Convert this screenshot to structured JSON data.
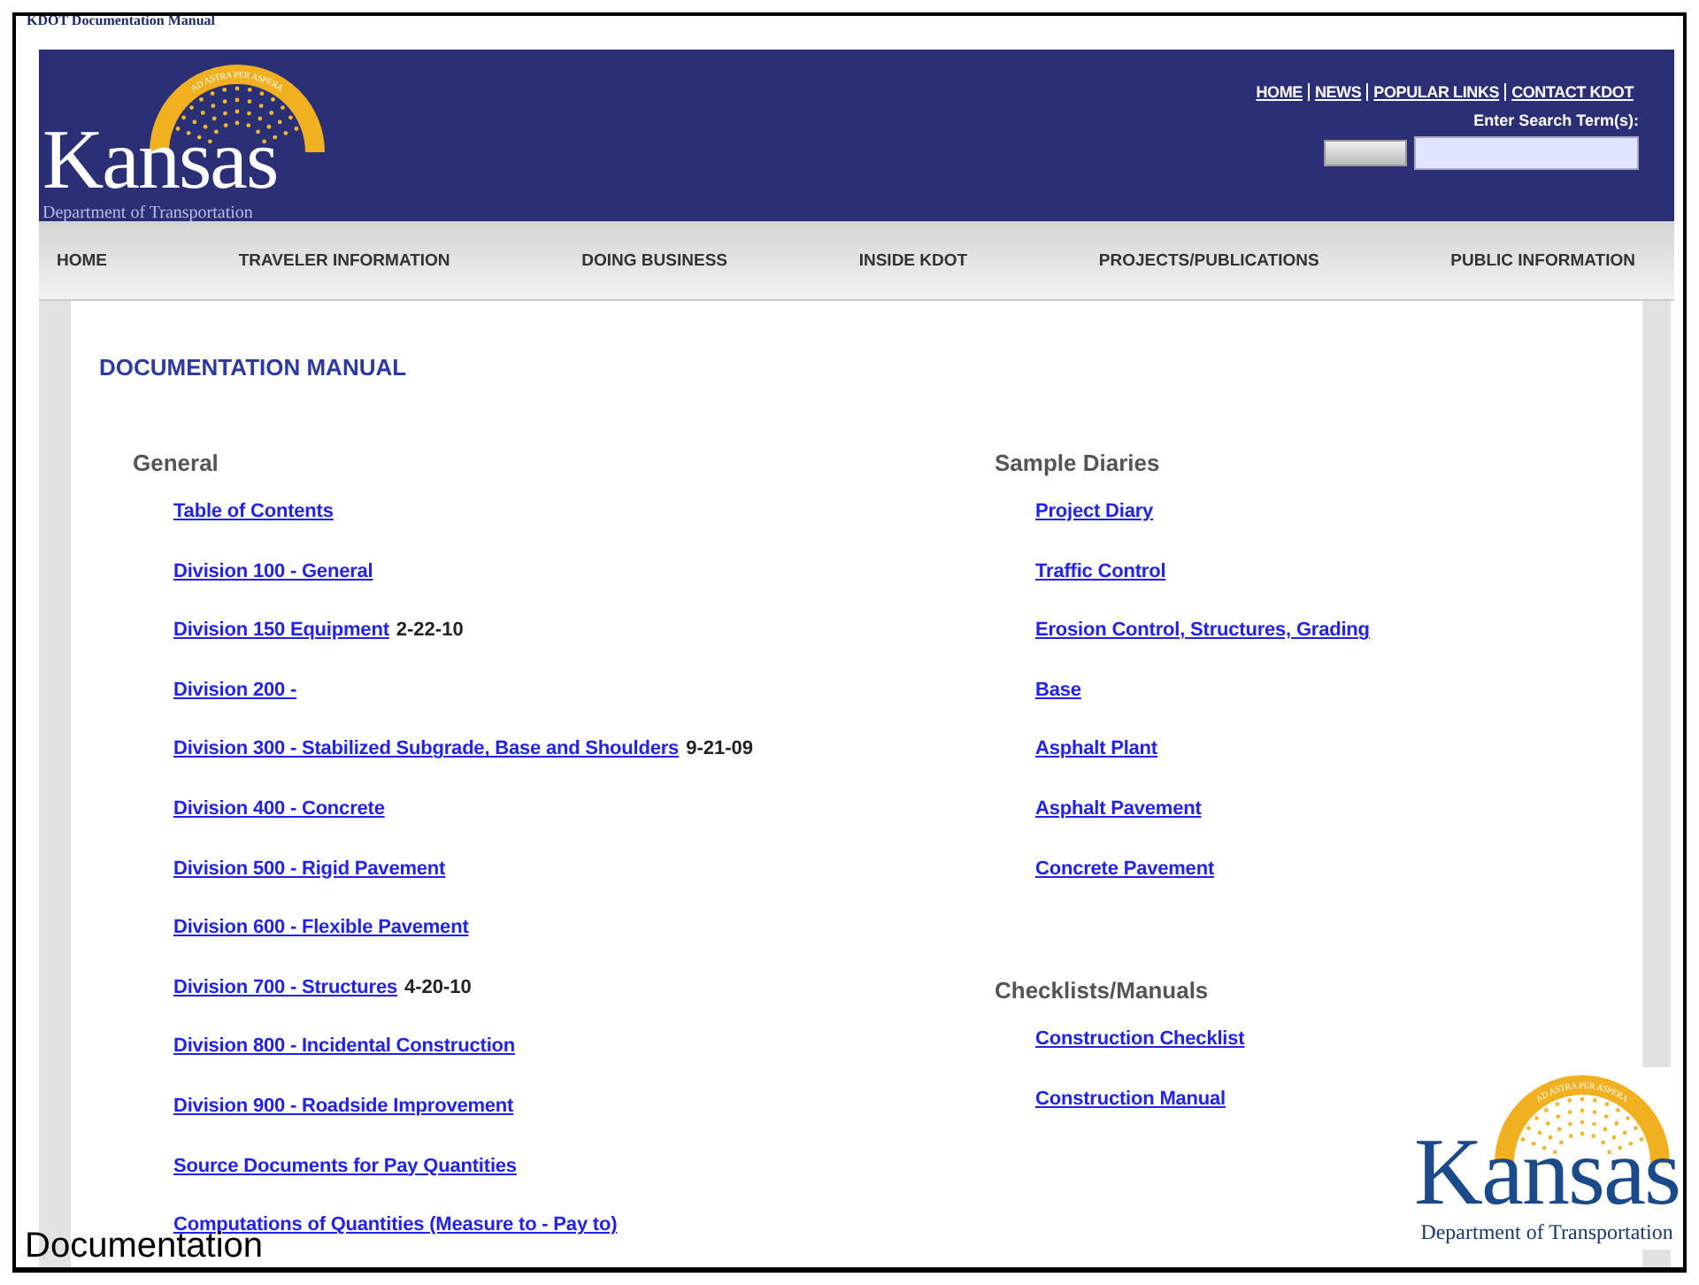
{
  "slide": {
    "title": "KDOT Documentation Manual",
    "caption": "Documentation"
  },
  "header": {
    "logo": {
      "motto": "AD ASTRA PER ASPERA",
      "wordmark": "Kansas",
      "subtitle": "Department of Transportation"
    },
    "top_links": [
      "HOME",
      "NEWS",
      "POPULAR LINKS",
      "CONTACT KDOT"
    ],
    "search": {
      "label": "Enter Search Term(s):"
    }
  },
  "nav": [
    "HOME",
    "TRAVELER INFORMATION",
    "DOING BUSINESS",
    "INSIDE KDOT",
    "PROJECTS/PUBLICATIONS",
    "PUBLIC INFORMATION"
  ],
  "page_title": "DOCUMENTATION MANUAL",
  "left_column": [
    {
      "heading": "General",
      "links": [
        {
          "text": "Table of Contents"
        },
        {
          "text": "Division 100 - General"
        },
        {
          "text": "Division 150 Equipment",
          "note": "2-22-10"
        },
        {
          "text": "Division 200 -"
        },
        {
          "text": "Division 300 - Stabilized Subgrade, Base and Shoulders",
          "note": "9-21-09"
        },
        {
          "text": "Division 400 - Concrete"
        },
        {
          "text": "Division 500 - Rigid Pavement"
        },
        {
          "text": "Division 600 - Flexible Pavement"
        },
        {
          "text": "Division 700 - Structures",
          "note": "4-20-10"
        },
        {
          "text": "Division 800 - Incidental Construction"
        },
        {
          "text": "Division 900 - Roadside Improvement"
        },
        {
          "text": "Source Documents for Pay Quantities"
        },
        {
          "text": "Computations of Quantities (Measure to - Pay to)"
        }
      ]
    }
  ],
  "right_column": [
    {
      "heading": "Sample Diaries",
      "links": [
        {
          "text": "Project Diary"
        },
        {
          "text": "Traffic Control"
        },
        {
          "text": "Erosion Control, Structures, Grading"
        },
        {
          "text": "Base"
        },
        {
          "text": "Asphalt Plant"
        },
        {
          "text": "Asphalt Pavement"
        },
        {
          "text": "Concrete Pavement"
        }
      ]
    },
    {
      "heading": "Checklists/Manuals",
      "links": [
        {
          "text": "Construction Checklist"
        },
        {
          "text": "Construction Manual"
        }
      ]
    }
  ],
  "corner_logo": {
    "motto": "AD ASTRA PER ASPERA",
    "wordmark": "Kansas",
    "subtitle": "Department of Transportation"
  }
}
